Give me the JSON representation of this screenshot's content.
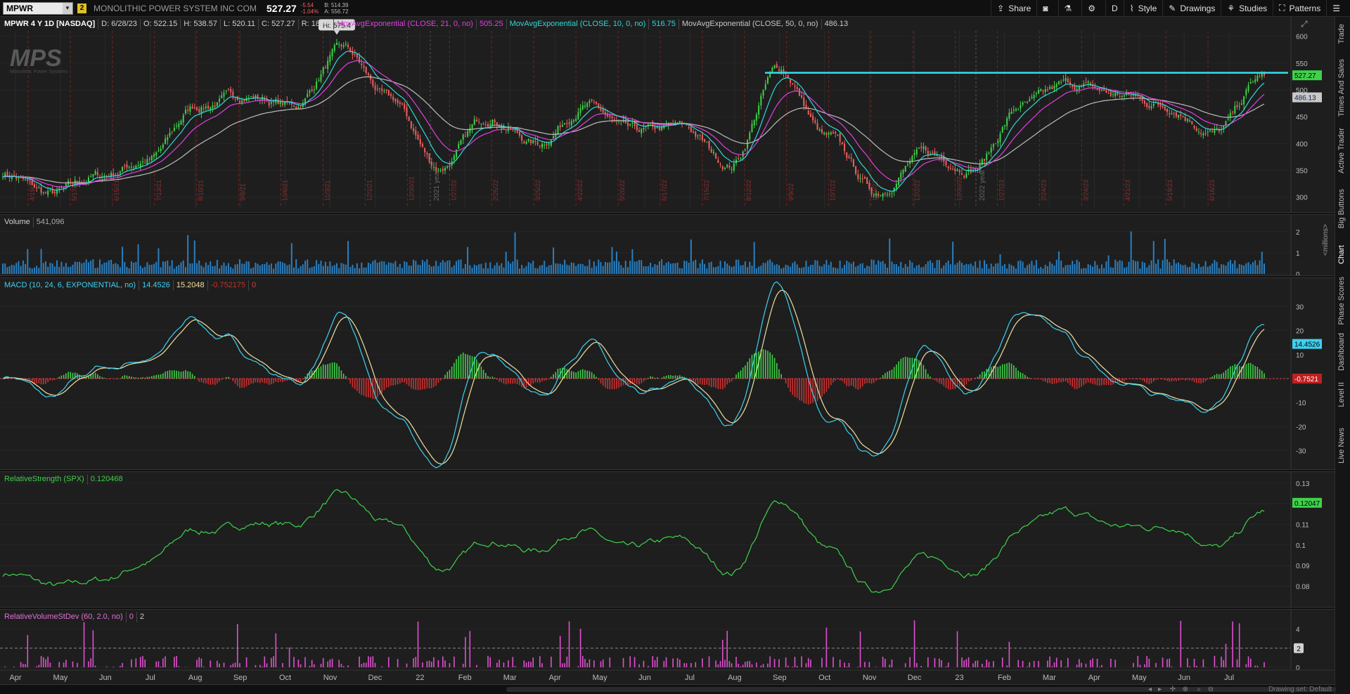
{
  "toolbar": {
    "symbol": "MPWR",
    "link_number": "2",
    "company": "MONOLITHIC POWER SYSTEM INC COM",
    "last": "527.27",
    "change": "-5.54",
    "change_pct": "-1.04%",
    "bid": "B: 514.39",
    "ask": "A: 556.72",
    "buttons": [
      {
        "name": "share",
        "label": "Share",
        "icon": "share-icon"
      },
      {
        "name": "snapshot",
        "label": "",
        "icon": "camera-icon"
      },
      {
        "name": "lab",
        "label": "",
        "icon": "flask-icon"
      },
      {
        "name": "settings",
        "label": "",
        "icon": "gear-icon"
      },
      {
        "name": "aggregation",
        "label": "D",
        "icon": ""
      },
      {
        "name": "style",
        "label": "Style",
        "icon": "style-icon"
      },
      {
        "name": "drawings",
        "label": "Drawings",
        "icon": "pencil-icon"
      },
      {
        "name": "studies",
        "label": "Studies",
        "icon": "studies-icon"
      },
      {
        "name": "patterns",
        "label": "Patterns",
        "icon": "patterns-icon"
      },
      {
        "name": "menu",
        "label": "",
        "icon": "menu-icon"
      }
    ]
  },
  "right_tabs": [
    "Trade",
    "Times And Sales",
    "Active Trader",
    "Big Buttons",
    "Chart",
    "Phase Scores",
    "Dashboard",
    "Level II",
    "Live News"
  ],
  "price_pane": {
    "title": "MPWR 4 Y 1D [NASDAQ]",
    "ohlc": [
      "D: 6/28/23",
      "O: 522.15",
      "H: 538.57",
      "L: 520.11",
      "C: 527.27",
      "R: 18.46"
    ],
    "studies": [
      {
        "label": "MovAvgExponential (CLOSE, 21, 0, no)",
        "value": "505.25",
        "color": "#e040e0"
      },
      {
        "label": "MovAvgExponential (CLOSE, 10, 0, no)",
        "value": "516.75",
        "color": "#30d8d8"
      },
      {
        "label": "MovAvgExponential (CLOSE, 50, 0, no)",
        "value": "486.13",
        "color": "#c8c8c8"
      }
    ],
    "hi_label": "Hi: 575.4",
    "watermark": "MPS",
    "watermark_sub": "Monolithic Power Systems",
    "price_tag": "527.27",
    "ema50_tag": "486.13",
    "y_ticks": [
      600,
      550,
      500,
      450,
      400,
      350,
      300
    ],
    "year_labels": [
      "2021 year",
      "2022 year"
    ],
    "date_labels": [
      "4/19/21",
      "5/17/21",
      "6/15/21",
      "7/13/21",
      "8/10/21",
      "9/8/21",
      "10/6/21",
      "11/3/21",
      "12/1/21",
      "12/30/21",
      "1/27/22",
      "2/25/22",
      "3/25/22",
      "4/22/22",
      "5/20/22",
      "6/17/22",
      "7/15/22",
      "8/12/22",
      "9/9/22",
      "10/7/22",
      "11/4/22",
      "12/2/22",
      "12/30/22",
      "1/27/23",
      "2/24/23",
      "3/24/23",
      "4/21/23",
      "5/19/23",
      "6/16/23"
    ],
    "resistance_level": 532
  },
  "volume_pane": {
    "title": "Volume",
    "value": "541,096",
    "y_ticks": [
      "2",
      "1",
      "0"
    ],
    "unit_label": "<millions>"
  },
  "macd_pane": {
    "title": "MACD (10, 24, 6, EXPONENTIAL, no)",
    "value": "14.4526",
    "avg": "15.2048",
    "diff": "-0.752175",
    "zero": "0",
    "y_ticks": [
      30,
      20,
      10,
      -10,
      -20,
      -30
    ],
    "value_tag": "14.4526",
    "diff_tag": "-0.7521"
  },
  "rs_pane": {
    "title": "RelativeStrength (SPX)",
    "value": "0.120468",
    "y_ticks": [
      "0.13",
      "0.12",
      "0.11",
      "0.1",
      "0.09",
      "0.08"
    ],
    "value_tag": "0.12047"
  },
  "rv_pane": {
    "title": "RelativeVolumeStDev (60, 2.0, no)",
    "value": "0",
    "threshold": "2",
    "y_ticks": [
      "4",
      "0"
    ],
    "threshold_tag": "2"
  },
  "x_axis": {
    "months": [
      "Apr",
      "May",
      "Jun",
      "Jul",
      "Aug",
      "Sep",
      "Oct",
      "Nov",
      "Dec",
      "22",
      "Feb",
      "Mar",
      "Apr",
      "May",
      "Jun",
      "Jul",
      "Aug",
      "Sep",
      "Oct",
      "Nov",
      "Dec",
      "23",
      "Feb",
      "Mar",
      "Apr",
      "May",
      "Jun",
      "Jul"
    ]
  },
  "bottom": {
    "drawing_set": "Drawing set: Default"
  },
  "colors": {
    "up": "#3fd14a",
    "down": "#f06060",
    "ema10": "#30d8d8",
    "ema21": "#e040e0",
    "ema50": "#bcbcbc",
    "resistance": "#30e0f0",
    "volume": "#2a7fc0",
    "macd": "#3fd0f0",
    "signal": "#f0e0a0",
    "rs": "#3fd14a",
    "rv": "#e050d0"
  },
  "chart_data": {
    "type": "line",
    "title": "MPWR 4 Y 1D [NASDAQ]",
    "series": [
      {
        "name": "MPWR",
        "x": [
          "Apr 21",
          "May 21",
          "Jun 21",
          "Jul 21",
          "Aug 21",
          "Sep 21",
          "Oct 21",
          "Nov 21",
          "Dec 21",
          "Jan 22",
          "Feb 22",
          "Mar 22",
          "Apr 22",
          "May 22",
          "Jun 22",
          "Jul 22",
          "Aug 22",
          "Sep 22",
          "Oct 22",
          "Nov 22",
          "Dec 22",
          "Jan 23",
          "Feb 23",
          "Mar 23",
          "Apr 23",
          "May 23",
          "Jun 23"
        ],
        "values": [
          345,
          305,
          340,
          370,
          470,
          490,
          470,
          575,
          480,
          355,
          450,
          400,
          470,
          420,
          430,
          360,
          540,
          410,
          310,
          380,
          355,
          470,
          510,
          490,
          470,
          420,
          527
        ]
      }
    ],
    "ylim": [
      280,
      610
    ]
  }
}
